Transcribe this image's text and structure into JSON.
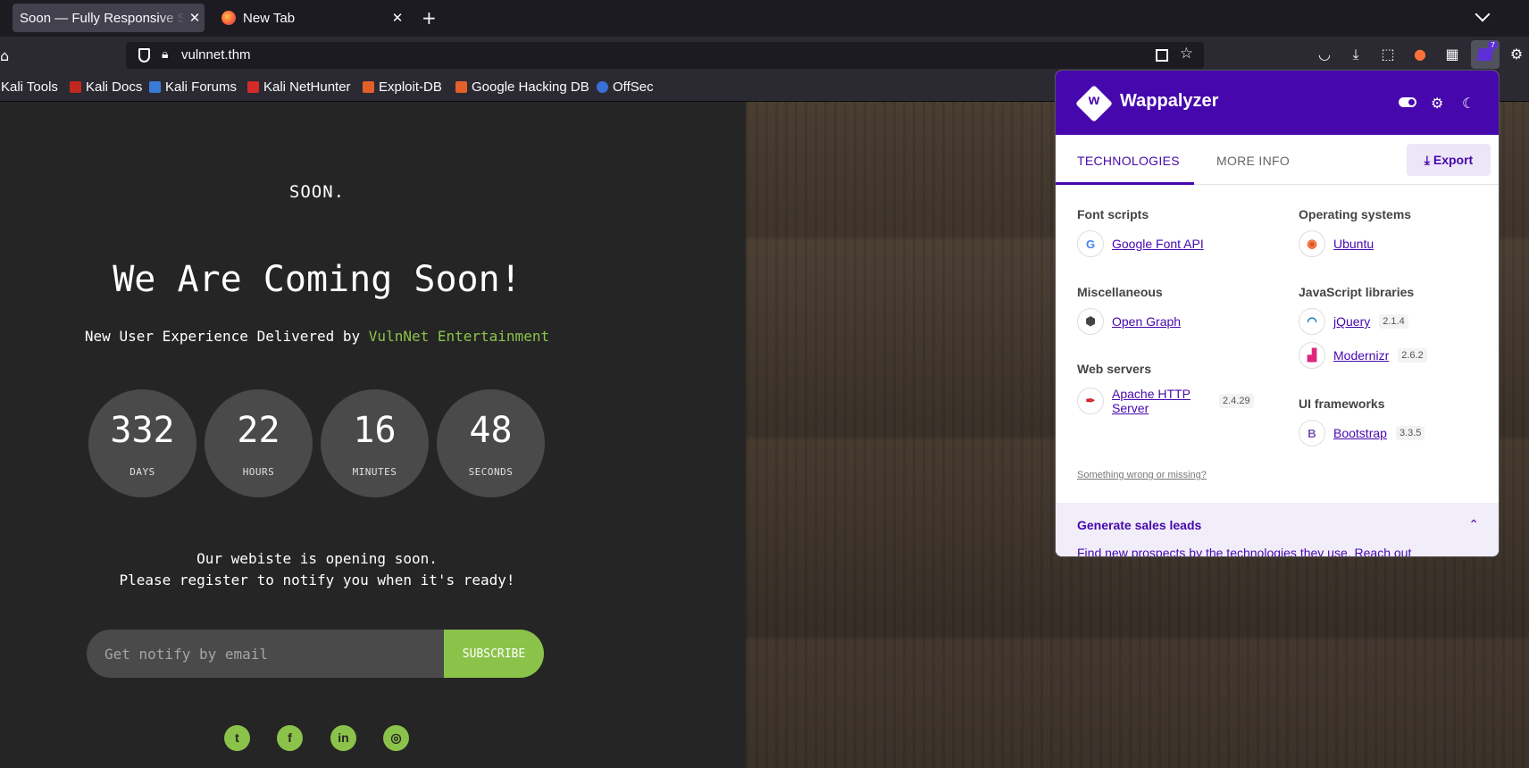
{
  "browser": {
    "tabs": [
      {
        "title": "Soon — Fully Responsive Software",
        "close": "✕"
      },
      {
        "title": "New Tab",
        "close": "✕"
      }
    ],
    "new_tab": "+",
    "url": "vulnnet.thm",
    "ext_badge": "7",
    "bookmarks": [
      "Kali Tools",
      "Kali Docs",
      "Kali Forums",
      "Kali NetHunter",
      "Exploit-DB",
      "Google Hacking DB",
      "OffSec"
    ]
  },
  "site": {
    "brand": "SOON.",
    "headline": "We Are Coming Soon!",
    "subline_prefix": "New User Experience Delivered by ",
    "subline_company": "VulnNet Entertainment",
    "countdown": [
      {
        "value": "332",
        "label": "DAYS"
      },
      {
        "value": "22",
        "label": "HOURS"
      },
      {
        "value": "16",
        "label": "MINUTES"
      },
      {
        "value": "48",
        "label": "SECONDS"
      }
    ],
    "message_line1": "Our webiste is opening soon.",
    "message_line2": "Please register to notify you when it's ready!",
    "email_placeholder": "Get notify by email",
    "subscribe_label": "SUBSCRIBE",
    "social_icons": [
      "twitter-icon",
      "facebook-icon",
      "linkedin-icon",
      "dribbble-icon"
    ]
  },
  "wappalyzer": {
    "title": "Wappalyzer",
    "tab_technologies": "TECHNOLOGIES",
    "tab_more_info": "MORE INFO",
    "export_label": "Export",
    "categories": {
      "font_scripts": {
        "title": "Font scripts",
        "items": [
          {
            "name": "Google Font API",
            "version": ""
          }
        ]
      },
      "misc": {
        "title": "Miscellaneous",
        "items": [
          {
            "name": "Open Graph",
            "version": ""
          }
        ]
      },
      "web_servers": {
        "title": "Web servers",
        "items": [
          {
            "name": "Apache HTTP Server",
            "version": "2.4.29"
          }
        ]
      },
      "os": {
        "title": "Operating systems",
        "items": [
          {
            "name": "Ubuntu",
            "version": ""
          }
        ]
      },
      "js": {
        "title": "JavaScript libraries",
        "items": [
          {
            "name": "jQuery",
            "version": "2.1.4"
          },
          {
            "name": "Modernizr",
            "version": "2.6.2"
          }
        ]
      },
      "ui": {
        "title": "UI frameworks",
        "items": [
          {
            "name": "Bootstrap",
            "version": "3.3.5"
          }
        ]
      }
    },
    "wrong_link": "Something wrong or missing?",
    "leads_title": "Generate sales leads",
    "leads_desc": "Find new prospects by the technologies they use. Reach out"
  },
  "colors": {
    "accent_green": "#8bc34a",
    "wappalyzer_purple": "#4608ad"
  }
}
